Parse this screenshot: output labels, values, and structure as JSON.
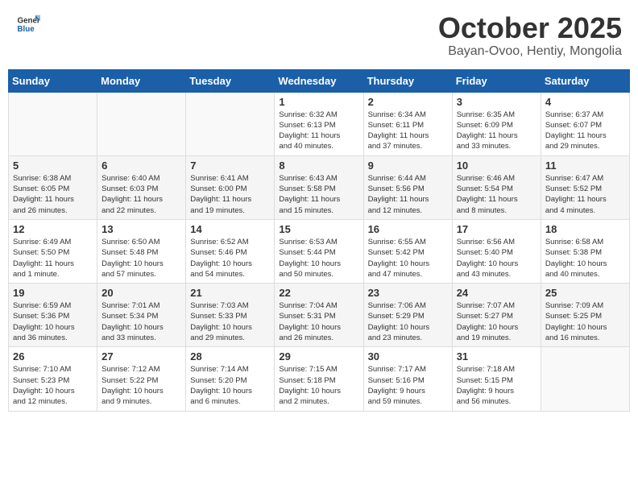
{
  "header": {
    "logo_line1": "General",
    "logo_line2": "Blue",
    "month_title": "October 2025",
    "subtitle": "Bayan-Ovoo, Hentiy, Mongolia"
  },
  "weekdays": [
    "Sunday",
    "Monday",
    "Tuesday",
    "Wednesday",
    "Thursday",
    "Friday",
    "Saturday"
  ],
  "weeks": [
    {
      "days": [
        {
          "number": "",
          "info": ""
        },
        {
          "number": "",
          "info": ""
        },
        {
          "number": "",
          "info": ""
        },
        {
          "number": "1",
          "info": "Sunrise: 6:32 AM\nSunset: 6:13 PM\nDaylight: 11 hours\nand 40 minutes."
        },
        {
          "number": "2",
          "info": "Sunrise: 6:34 AM\nSunset: 6:11 PM\nDaylight: 11 hours\nand 37 minutes."
        },
        {
          "number": "3",
          "info": "Sunrise: 6:35 AM\nSunset: 6:09 PM\nDaylight: 11 hours\nand 33 minutes."
        },
        {
          "number": "4",
          "info": "Sunrise: 6:37 AM\nSunset: 6:07 PM\nDaylight: 11 hours\nand 29 minutes."
        }
      ]
    },
    {
      "days": [
        {
          "number": "5",
          "info": "Sunrise: 6:38 AM\nSunset: 6:05 PM\nDaylight: 11 hours\nand 26 minutes."
        },
        {
          "number": "6",
          "info": "Sunrise: 6:40 AM\nSunset: 6:03 PM\nDaylight: 11 hours\nand 22 minutes."
        },
        {
          "number": "7",
          "info": "Sunrise: 6:41 AM\nSunset: 6:00 PM\nDaylight: 11 hours\nand 19 minutes."
        },
        {
          "number": "8",
          "info": "Sunrise: 6:43 AM\nSunset: 5:58 PM\nDaylight: 11 hours\nand 15 minutes."
        },
        {
          "number": "9",
          "info": "Sunrise: 6:44 AM\nSunset: 5:56 PM\nDaylight: 11 hours\nand 12 minutes."
        },
        {
          "number": "10",
          "info": "Sunrise: 6:46 AM\nSunset: 5:54 PM\nDaylight: 11 hours\nand 8 minutes."
        },
        {
          "number": "11",
          "info": "Sunrise: 6:47 AM\nSunset: 5:52 PM\nDaylight: 11 hours\nand 4 minutes."
        }
      ]
    },
    {
      "days": [
        {
          "number": "12",
          "info": "Sunrise: 6:49 AM\nSunset: 5:50 PM\nDaylight: 11 hours\nand 1 minute."
        },
        {
          "number": "13",
          "info": "Sunrise: 6:50 AM\nSunset: 5:48 PM\nDaylight: 10 hours\nand 57 minutes."
        },
        {
          "number": "14",
          "info": "Sunrise: 6:52 AM\nSunset: 5:46 PM\nDaylight: 10 hours\nand 54 minutes."
        },
        {
          "number": "15",
          "info": "Sunrise: 6:53 AM\nSunset: 5:44 PM\nDaylight: 10 hours\nand 50 minutes."
        },
        {
          "number": "16",
          "info": "Sunrise: 6:55 AM\nSunset: 5:42 PM\nDaylight: 10 hours\nand 47 minutes."
        },
        {
          "number": "17",
          "info": "Sunrise: 6:56 AM\nSunset: 5:40 PM\nDaylight: 10 hours\nand 43 minutes."
        },
        {
          "number": "18",
          "info": "Sunrise: 6:58 AM\nSunset: 5:38 PM\nDaylight: 10 hours\nand 40 minutes."
        }
      ]
    },
    {
      "days": [
        {
          "number": "19",
          "info": "Sunrise: 6:59 AM\nSunset: 5:36 PM\nDaylight: 10 hours\nand 36 minutes."
        },
        {
          "number": "20",
          "info": "Sunrise: 7:01 AM\nSunset: 5:34 PM\nDaylight: 10 hours\nand 33 minutes."
        },
        {
          "number": "21",
          "info": "Sunrise: 7:03 AM\nSunset: 5:33 PM\nDaylight: 10 hours\nand 29 minutes."
        },
        {
          "number": "22",
          "info": "Sunrise: 7:04 AM\nSunset: 5:31 PM\nDaylight: 10 hours\nand 26 minutes."
        },
        {
          "number": "23",
          "info": "Sunrise: 7:06 AM\nSunset: 5:29 PM\nDaylight: 10 hours\nand 23 minutes."
        },
        {
          "number": "24",
          "info": "Sunrise: 7:07 AM\nSunset: 5:27 PM\nDaylight: 10 hours\nand 19 minutes."
        },
        {
          "number": "25",
          "info": "Sunrise: 7:09 AM\nSunset: 5:25 PM\nDaylight: 10 hours\nand 16 minutes."
        }
      ]
    },
    {
      "days": [
        {
          "number": "26",
          "info": "Sunrise: 7:10 AM\nSunset: 5:23 PM\nDaylight: 10 hours\nand 12 minutes."
        },
        {
          "number": "27",
          "info": "Sunrise: 7:12 AM\nSunset: 5:22 PM\nDaylight: 10 hours\nand 9 minutes."
        },
        {
          "number": "28",
          "info": "Sunrise: 7:14 AM\nSunset: 5:20 PM\nDaylight: 10 hours\nand 6 minutes."
        },
        {
          "number": "29",
          "info": "Sunrise: 7:15 AM\nSunset: 5:18 PM\nDaylight: 10 hours\nand 2 minutes."
        },
        {
          "number": "30",
          "info": "Sunrise: 7:17 AM\nSunset: 5:16 PM\nDaylight: 9 hours\nand 59 minutes."
        },
        {
          "number": "31",
          "info": "Sunrise: 7:18 AM\nSunset: 5:15 PM\nDaylight: 9 hours\nand 56 minutes."
        },
        {
          "number": "",
          "info": ""
        }
      ]
    }
  ]
}
